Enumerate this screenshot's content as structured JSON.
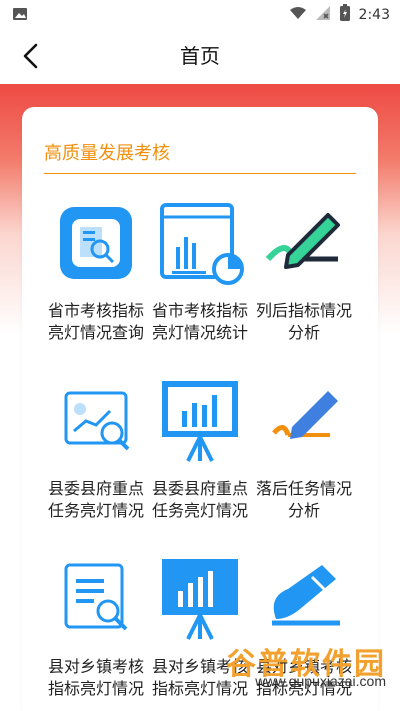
{
  "status_bar": {
    "time": "2:43",
    "icons": [
      "image-icon",
      "wifi-icon",
      "no-signal-icon",
      "battery-icon"
    ]
  },
  "app_bar": {
    "title": "首页",
    "back_icon": "chevron-left-icon"
  },
  "section": {
    "title": "高质量发展考核",
    "accent_color": "#f2900e",
    "header_gradient": [
      "#ee4a44",
      "#ffffff"
    ]
  },
  "tiles": [
    {
      "label": "省市考核指标亮灯情况查询",
      "icon": "report-search-icon",
      "color": "#2196f3"
    },
    {
      "label": "省市考核指标亮灯情况统计报表",
      "icon": "chart-report-icon",
      "color": "#2196f3"
    },
    {
      "label": "列后指标情况分析",
      "icon": "pen-analysis-icon",
      "color": "#1e2a3a"
    },
    {
      "label": "县委县府重点任务亮灯情况查询",
      "icon": "image-search-icon",
      "color": "#2196f3"
    },
    {
      "label": "县委县府重点任务亮灯情况统计报表",
      "icon": "presentation-chart-icon",
      "color": "#2196f3"
    },
    {
      "label": "落后任务情况分析",
      "icon": "pencil-icon",
      "color": "#3f7fe0"
    },
    {
      "label": "县对乡镇考核指标亮灯情况查询",
      "icon": "document-search-icon",
      "color": "#2196f3"
    },
    {
      "label": "县对乡镇考核指标亮灯情况统计报表",
      "icon": "board-chart-icon",
      "color": "#2196f3"
    },
    {
      "label": "县对乡镇考核指标亮灯情况分析",
      "icon": "pen-curve-icon",
      "color": "#2196f3"
    }
  ],
  "watermark": {
    "title": "谷普软件园",
    "url": "www.gupuxiazai.com"
  }
}
